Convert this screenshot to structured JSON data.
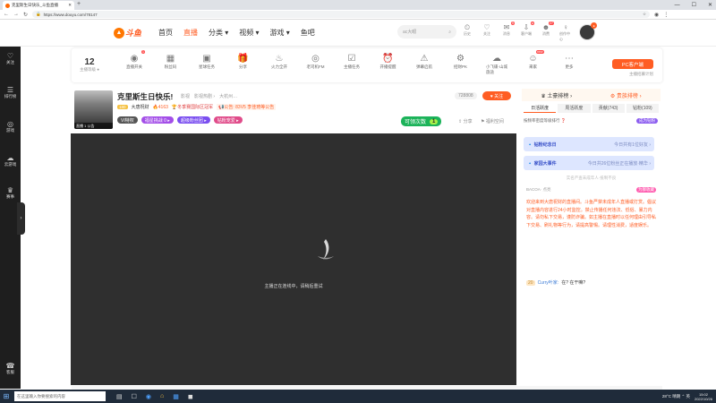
{
  "browser": {
    "tab_title": "克里斯生日快乐_斗鱼直播",
    "new_tab": "+",
    "url": "https://www.douyu.com/78147",
    "win": [
      "—",
      "☐",
      "✕"
    ]
  },
  "site": {
    "logo_text": "斗鱼",
    "nav": [
      {
        "label": "首页",
        "active": false
      },
      {
        "label": "直播",
        "active": true
      },
      {
        "label": "分类 ▾",
        "active": false
      },
      {
        "label": "视频 ▾",
        "active": false
      },
      {
        "label": "游戏 ▾",
        "active": false
      },
      {
        "label": "鱼吧",
        "active": false
      }
    ],
    "search_placeholder": "ac大眼",
    "header_icons": [
      {
        "name": "history",
        "label": "历史",
        "glyph": "⏲",
        "badge": ""
      },
      {
        "name": "follow",
        "label": "关注",
        "glyph": "♡",
        "badge": ""
      },
      {
        "name": "message",
        "label": "消息",
        "glyph": "✉",
        "badge": "5"
      },
      {
        "name": "client",
        "label": "客户端",
        "glyph": "⇩",
        "badge": "●"
      },
      {
        "name": "mall",
        "label": "消费",
        "glyph": "☻",
        "badge": "27"
      },
      {
        "name": "live",
        "label": "创作中心",
        "glyph": "♀",
        "badge": ""
      }
    ],
    "avatar_badge": "●"
  },
  "sidebar": [
    {
      "name": "follow",
      "label": "关注",
      "glyph": "♡"
    },
    {
      "name": "rank",
      "label": "排行榜",
      "glyph": "☰"
    },
    {
      "name": "games",
      "label": "游戏",
      "glyph": "◎"
    },
    {
      "name": "cloud",
      "label": "云游戏",
      "glyph": "☁"
    },
    {
      "name": "match",
      "label": "赛事",
      "glyph": "♛"
    },
    {
      "name": "service",
      "label": "客服",
      "glyph": "☎"
    }
  ],
  "sidebar_toggle": "›",
  "toolbar": {
    "level_num": "12",
    "level_label": "主播等级 ●",
    "items": [
      {
        "name": "task",
        "label": "直播开关",
        "glyph": "◉",
        "badge": "1"
      },
      {
        "name": "fans",
        "label": "粉丝码",
        "glyph": "▦",
        "badge": ""
      },
      {
        "name": "ad",
        "label": "星球任务",
        "glyph": "▣",
        "badge": ""
      },
      {
        "name": "gift",
        "label": "分享",
        "glyph": "🎁",
        "badge": ""
      },
      {
        "name": "power",
        "label": "火力全开",
        "glyph": "♨",
        "badge": ""
      },
      {
        "name": "anchor",
        "label": "老司机FM",
        "glyph": "◎",
        "badge": ""
      },
      {
        "name": "check",
        "label": "主播任务",
        "glyph": "☑",
        "badge": ""
      },
      {
        "name": "alarm",
        "label": "开播提醒",
        "glyph": "⏰",
        "badge": ""
      },
      {
        "name": "warn",
        "label": "弹幕启航",
        "glyph": "⚠",
        "badge": ""
      },
      {
        "name": "pk",
        "label": "招财PK",
        "glyph": "⚙",
        "badge": ""
      },
      {
        "name": "cloud",
        "label": "小飞碟·山城旅途",
        "glyph": "☁",
        "badge": ""
      },
      {
        "name": "friends",
        "label": "来家",
        "glyph": "☺",
        "badge": "new"
      },
      {
        "name": "more",
        "label": "更多",
        "glyph": "⋯",
        "badge": ""
      }
    ],
    "pc_button": "PC客户端",
    "pc_sub": "主播招募计划"
  },
  "room": {
    "title": "克里斯生日快乐!",
    "categories": [
      "影视",
      "影视热剧 ›",
      "大杭州…"
    ],
    "level_badge": "180",
    "anchor": "大唐祝财",
    "hot": "🔥4163",
    "achievement": "🏆冬季赛国际区冠军",
    "notice": "📢公告: 83V5 李佳琦等公告",
    "pills": [
      {
        "label": "VI特权",
        "color": "#555"
      },
      {
        "label": "福星挑战 0 ▸",
        "color": "#a34ee8"
      },
      {
        "label": "超级粉丝团 ▸",
        "color": "#7a4ef0"
      },
      {
        "label": "钻粉宠爱 ▸",
        "color": "#e04c8a"
      }
    ],
    "anchor_caption": "直播 1 公告",
    "room_id": "728808",
    "follow": "♥ 关注",
    "pick_label": "可领次数",
    "pick_count": "1",
    "share": "⇪ 分享",
    "report": "⚑ 福利空间"
  },
  "player": {
    "message": "主播正在连线中，请稍后重试"
  },
  "rpanel": {
    "tabs": [
      {
        "label": "♛ 土豪排榜 ›",
        "active": false
      },
      {
        "label": "⚙ 贵族排榜 ›",
        "active": true
      }
    ],
    "subtabs": [
      {
        "label": "日活跃度",
        "active": true
      },
      {
        "label": "周活跃度",
        "active": false
      },
      {
        "label": "贡献(743)",
        "active": false
      },
      {
        "label": "钻粉(109)",
        "active": false
      }
    ],
    "rank_note": "按频率密度等级排行 ❓",
    "rank_badge": "成为钻粉",
    "banner1": {
      "title": "🔹 钻粉纪念日",
      "sub": "今日共有1位好友 ›"
    },
    "banner2": {
      "title": "🔹 家园大事件",
      "sub": "今日共26位粉丝正在播放·精华 ›"
    },
    "priv_note": "实名严查未成年人·抵制不良",
    "msg1_user": "BACOA· 点亮",
    "msg1_badge": "为群收藏",
    "sys": "欢迎来到大唐祝财的直播间。斗鱼严禁未成年人直播或打赏。倡议对直播内容进行24小时监控。禁止传播任何违法、低俗、暴力内容。请勿私下交易，谨防诈骗。如主播在直播时以任何理由引导私下交易、刷礼物等行为，请提高警惕。请理性消费，适度娱乐。",
    "chat_lv": "20",
    "chat_user": "Curry叶家:",
    "chat_text": "在? 在干嘛?"
  },
  "taskbar": {
    "search": "在这里输入你要搜索的内容",
    "apps": [
      "▤",
      "☐",
      "◉",
      "⌂",
      "▦",
      "◼"
    ],
    "tray": "28°C 晴朗 ⌃ 英",
    "time": "15:02",
    "date": "2022/10/26"
  },
  "colors": {
    "accent": "#ff5d23",
    "dark": "#1e1e1e",
    "player": "#2f2f2f"
  }
}
